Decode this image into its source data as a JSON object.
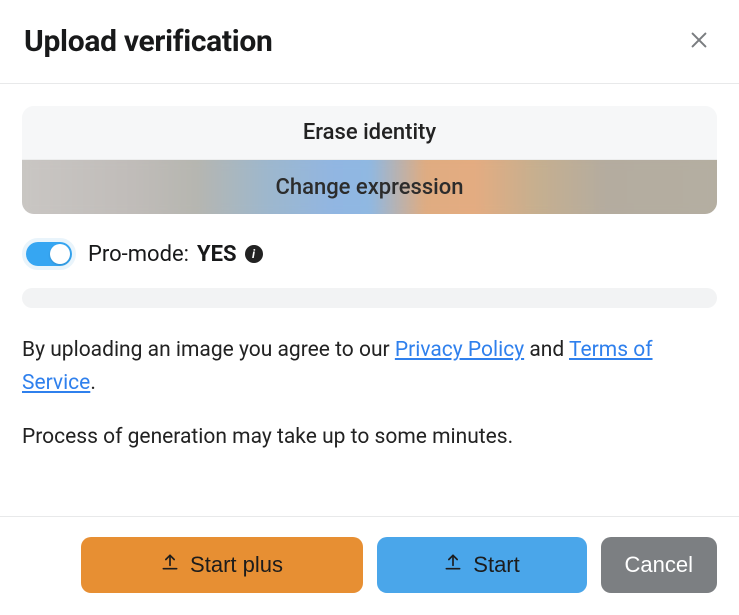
{
  "header": {
    "title": "Upload verification"
  },
  "tabs": {
    "erase": "Erase identity",
    "change": "Change expression"
  },
  "pro": {
    "label": "Pro-mode:",
    "value": "YES",
    "enabled": true
  },
  "agreement": {
    "prefix": "By uploading an image you agree to our ",
    "privacy": "Privacy Policy",
    "middle": " and ",
    "terms": "Terms of Service",
    "suffix": "."
  },
  "note": "Process of generation may take up to some minutes.",
  "actions": {
    "start_plus": "Start plus",
    "start": "Start",
    "cancel": "Cancel"
  }
}
